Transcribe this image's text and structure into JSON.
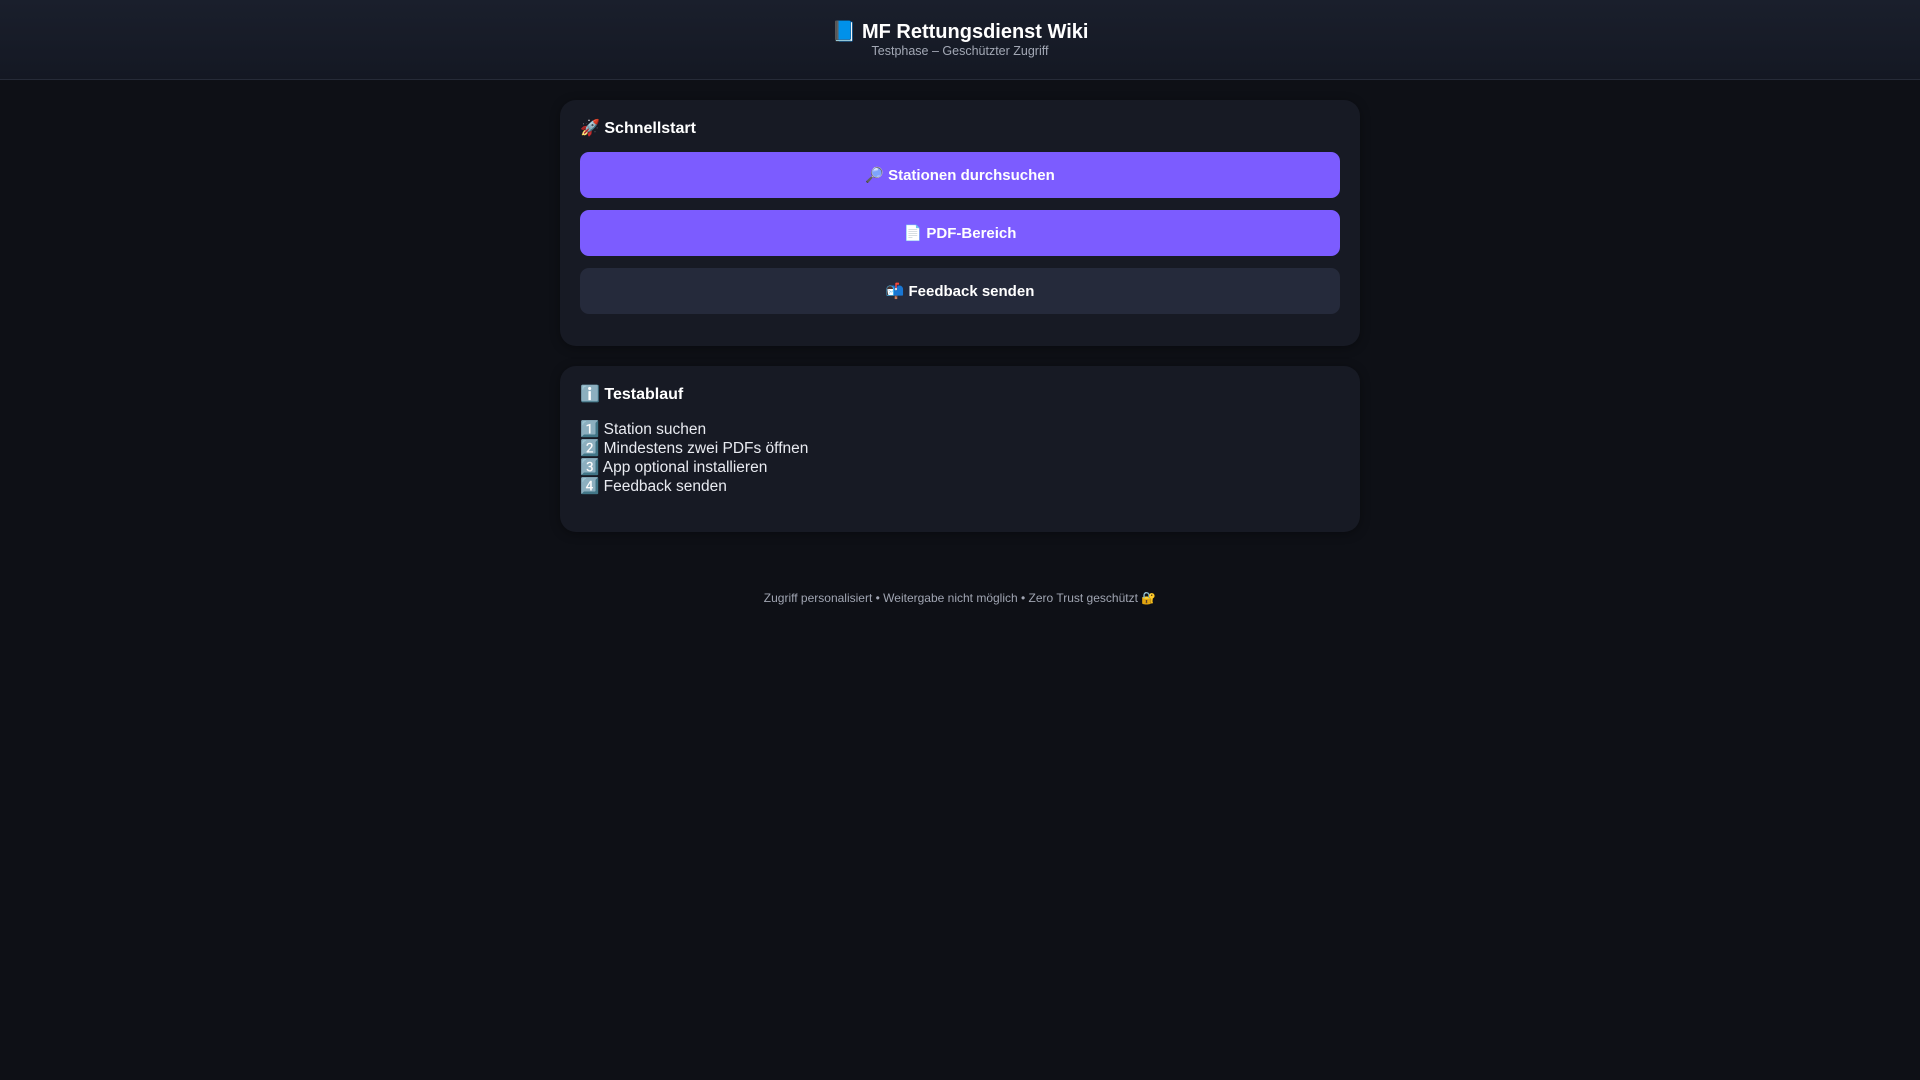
{
  "header": {
    "title": "📘 MF Rettungsdienst Wiki",
    "subtitle": "Testphase – Geschützter Zugriff"
  },
  "quickstart": {
    "title": "🚀 Schnellstart",
    "buttons": [
      {
        "label": "🔎 Stationen durchsuchen"
      },
      {
        "label": "📄 PDF-Bereich"
      },
      {
        "label": "📬 Feedback senden"
      }
    ]
  },
  "testablauf": {
    "title": "ℹ️ Testablauf",
    "steps": [
      "1️⃣ Station suchen",
      "2️⃣ Mindestens zwei PDFs öffnen",
      "3️⃣ App optional installieren",
      "4️⃣ Feedback senden"
    ]
  },
  "footer": {
    "text": "Zugriff personalisiert • Weitergabe nicht möglich • Zero Trust geschützt 🔐"
  },
  "colors": {
    "background": "#0e1016",
    "card": "#171a24",
    "primary": "#7c5cff",
    "secondary": "#252a3b"
  }
}
